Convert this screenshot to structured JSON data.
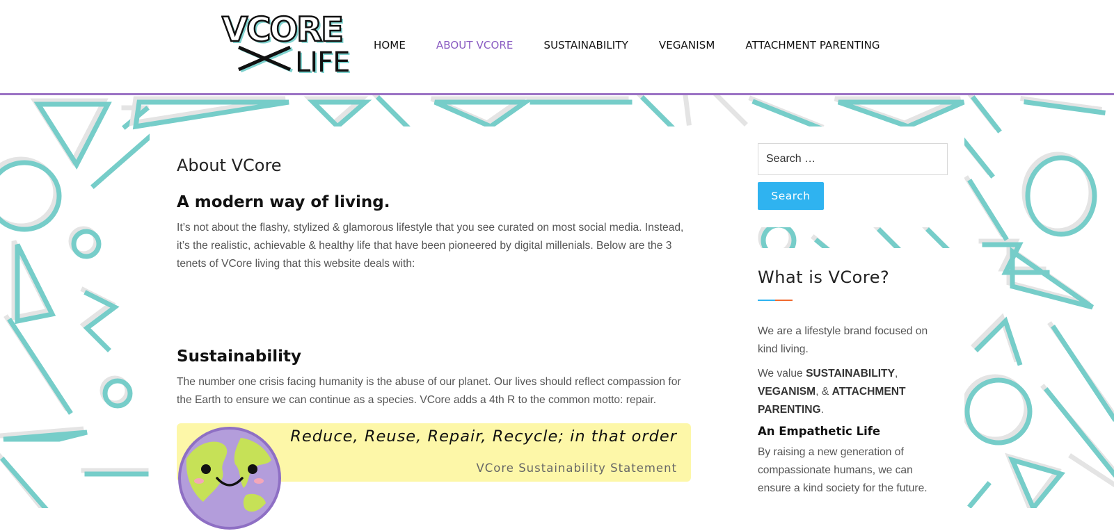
{
  "header": {
    "logo_text": [
      "VCORE",
      "LIFE"
    ],
    "nav": [
      {
        "label": "HOME",
        "active": false
      },
      {
        "label": "ABOUT VCORE",
        "active": true
      },
      {
        "label": "SUSTAINABILITY",
        "active": false
      },
      {
        "label": "VEGANISM",
        "active": false
      },
      {
        "label": "ATTACHMENT PARENTING",
        "active": false
      }
    ]
  },
  "main": {
    "page_title": "About VCore",
    "heading_modern": "A modern way of living.",
    "intro": "It’s not about the flashy, stylized & glamorous lifestyle that you see curated on most social media. Instead, it’s the realistic, achievable & healthy life that have been pioneered by digital millenials. Below are the 3 tenets of VCore living that this website deals with:",
    "heading_sustainability": "Sustainability",
    "sustainability_text": "The number one crisis facing humanity is the abuse of our planet. Our lives should reflect compassion for the Earth to ensure we can continue as a species. VCore adds a 4th R to the common motto: repair.",
    "quote": "Reduce, Reuse, Repair, Recycle; in that order",
    "quote_cite": "VCore Sustainability Statement"
  },
  "sidebar": {
    "search": {
      "placeholder": "Search …",
      "button": "Search"
    },
    "about": {
      "title": "What is VCore?",
      "p1": "We are a lifestyle brand focused on kind living.",
      "p2_prefix": "We value ",
      "p2_sustainability": "SUSTAINABILITY",
      "p2_sep1": ", ",
      "p2_veganism": "VEGANISM",
      "p2_sep2": ", & ",
      "p2_attachment": "ATTACHMENT PARENTING",
      "p2_end": ".",
      "empathetic_heading": "An Empathetic Life",
      "p3": "By raising a new generation of compassionate humans, we can ensure a kind society for the future."
    }
  },
  "colors": {
    "accent_purple": "#8a5cc2",
    "header_border": "#9b72c4",
    "button_blue": "#2fb3f0",
    "underline_orange": "#f06a2f",
    "quote_bg": "#fdf7a8",
    "pattern_teal": "#76cdc9",
    "pattern_gray": "#e4e4e4"
  }
}
